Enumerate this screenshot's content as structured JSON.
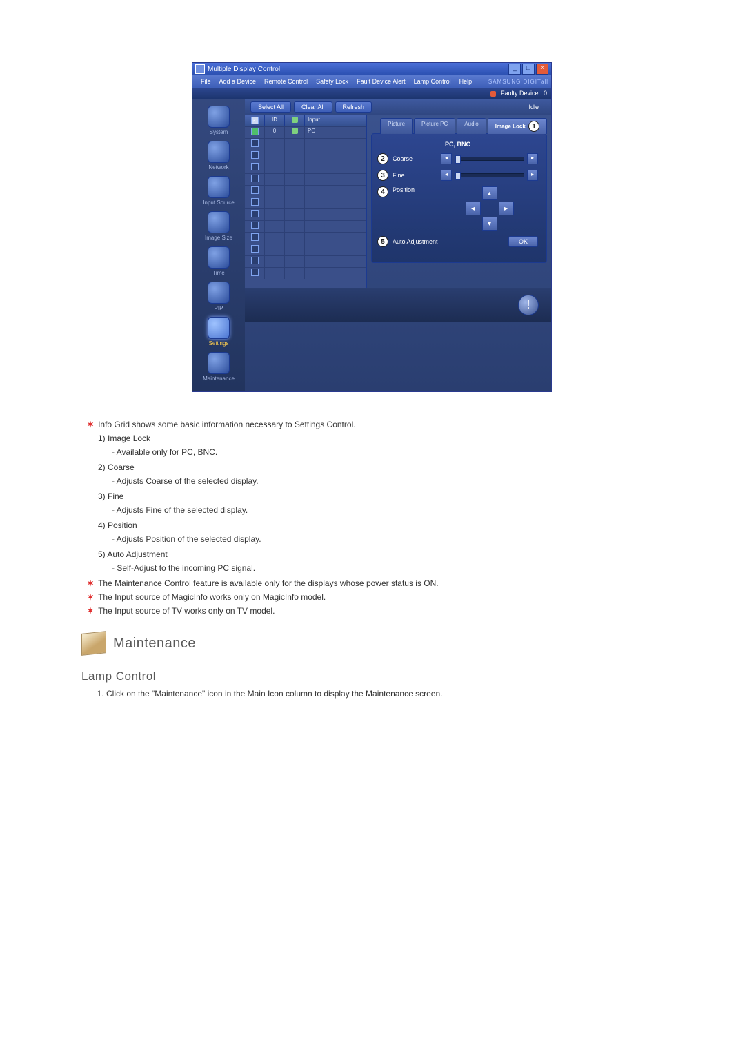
{
  "window": {
    "title": "Multiple Display Control",
    "brand": "SAMSUNG DIGITall"
  },
  "menubar": {
    "items": [
      "File",
      "Add a Device",
      "Remote Control",
      "Safety Lock",
      "Fault Device Alert",
      "Lamp Control",
      "Help"
    ]
  },
  "status": {
    "faulty_label": "Faulty Device : 0"
  },
  "toolbar": {
    "select_all": "Select All",
    "clear_all": "Clear All",
    "refresh": "Refresh",
    "idle": "Idle"
  },
  "sidebar": {
    "items": [
      {
        "label": "System"
      },
      {
        "label": "Network"
      },
      {
        "label": "Input Source"
      },
      {
        "label": "Image Size"
      },
      {
        "label": "Time"
      },
      {
        "label": "PIP"
      },
      {
        "label": "Settings",
        "selected": true
      },
      {
        "label": "Maintenance"
      }
    ]
  },
  "grid": {
    "headers": {
      "c1": "",
      "c2": "ID",
      "c3": "",
      "c4": "Input"
    },
    "row0": {
      "id": "0",
      "input": "PC"
    }
  },
  "tabs": {
    "picture": "Picture",
    "picture_pc": "Picture PC",
    "audio": "Audio",
    "image_lock": "Image Lock"
  },
  "panel": {
    "title": "PC, BNC",
    "coarse": "Coarse",
    "fine": "Fine",
    "position": "Position",
    "auto_adjust": "Auto Adjustment",
    "ok": "OK"
  },
  "badges": {
    "n1": "1",
    "n2": "2",
    "n3": "3",
    "n4": "4",
    "n5": "5"
  },
  "doc": {
    "intro": "Info Grid shows some basic information necessary to Settings Control.",
    "i1_t": "1) Image Lock",
    "i1_d": "- Available only for PC, BNC.",
    "i2_t": "2) Coarse",
    "i2_d": "- Adjusts Coarse of the selected display.",
    "i3_t": "3) Fine",
    "i3_d": "- Adjusts Fine of the selected display.",
    "i4_t": "4) Position",
    "i4_d": "- Adjusts Position of the selected display.",
    "i5_t": "5) Auto Adjustment",
    "i5_d": "- Self-Adjust to the incoming PC signal.",
    "note1": "The Maintenance Control feature is available only for the displays whose power status is ON.",
    "note2": "The Input source of MagicInfo works only on MagicInfo model.",
    "note3": "The Input source of TV works only on TV model.",
    "section_title": "Maintenance",
    "subsection_title": "Lamp Control",
    "step1": "Click on the \"Maintenance\" icon in the Main Icon column to display the Maintenance screen."
  }
}
